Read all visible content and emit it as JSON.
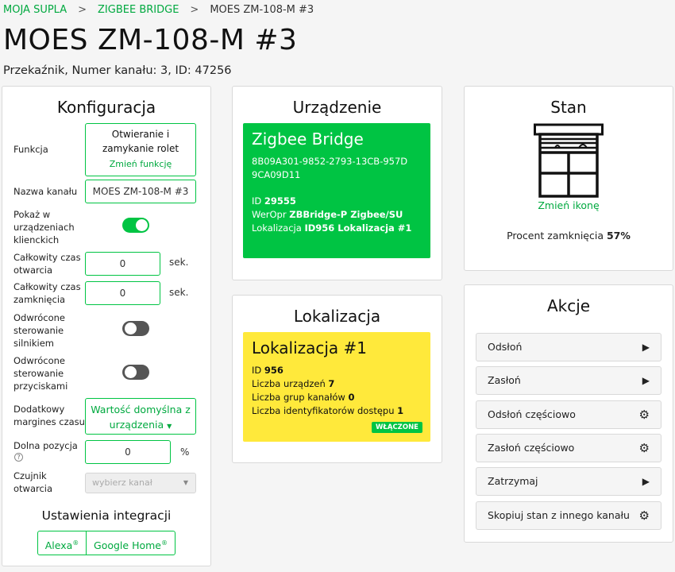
{
  "breadcrumb": {
    "item1": "MOJA SUPLA",
    "sep1": ">",
    "item2": "ZIGBEE BRIDGE",
    "sep2": ">",
    "item3": "MOES ZM-108-M #3"
  },
  "page": {
    "title": "MOES ZM-108-M #3",
    "subtitle": "Przekaźnik, Numer kanału: 3, ID: 47256"
  },
  "config": {
    "title": "Konfiguracja",
    "function_label": "Funkcja",
    "function_value": "Otwieranie i zamykanie rolet",
    "function_change": "Zmień funkcję",
    "channel_name_label": "Nazwa kanału",
    "channel_name_value": "MOES ZM-108-M #3",
    "show_in_clients_label": "Pokaż w urządzeniach klienckich",
    "show_in_clients": true,
    "open_time_label": "Całkowity czas otwarcia",
    "open_time_value": "0",
    "close_time_label": "Całkowity czas zamknięcia",
    "close_time_value": "0",
    "time_unit": "sek.",
    "reversed_motor_label": "Odwrócone sterowanie silnikiem",
    "reversed_motor": false,
    "reversed_buttons_label": "Odwrócone sterowanie przyciskami",
    "reversed_buttons": false,
    "margins_label": "Dodatkowy margines czasu",
    "margins_value": "Wartość domyślna z urządzenia",
    "bottom_pos_label": "Dolna pozycja",
    "bottom_pos_value": "0",
    "bottom_pos_unit": "%",
    "sensor_label": "Czujnik otwarcia",
    "sensor_placeholder": "wybierz kanał",
    "integrations_title": "Ustawienia integracji",
    "alexa": "Alexa",
    "google": "Google Home",
    "reg": "®"
  },
  "device": {
    "title": "Urządzenie",
    "name": "Zigbee Bridge",
    "guid": "8B09A301-9852-2793-13CB-957D9CA09D11",
    "id_label": "ID",
    "id_value": "29555",
    "weropr_label": "WerOpr",
    "weropr_value": "ZBBridge-P Zigbee/SU",
    "loc_label": "Lokalizacja",
    "loc_value": "ID956 Lokalizacja #1",
    "color": "#00c443"
  },
  "location": {
    "title": "Lokalizacja",
    "name": "Lokalizacja #1",
    "id_label": "ID",
    "id_value": "956",
    "devices_label": "Liczba urządzeń",
    "devices_value": "7",
    "groups_label": "Liczba grup kanałów",
    "groups_value": "0",
    "access_label": "Liczba identyfikatorów dostępu",
    "access_value": "1",
    "badge": "WŁĄCZONE",
    "color": "#ffe93b"
  },
  "state": {
    "title": "Stan",
    "icon": "roller-blind-window-icon",
    "change_icon": "Zmień ikonę",
    "percent_label": "Procent zamknięcia",
    "percent_value": "57%"
  },
  "actions": {
    "title": "Akcje",
    "items": [
      {
        "label": "Odsłoń",
        "icon": "play-icon"
      },
      {
        "label": "Zasłoń",
        "icon": "play-icon"
      },
      {
        "label": "Odsłoń częściowo",
        "icon": "gear-icon"
      },
      {
        "label": "Zasłoń częściowo",
        "icon": "gear-icon"
      },
      {
        "label": "Zatrzymaj",
        "icon": "play-icon"
      },
      {
        "label": "Skopiuj stan z innego kanału",
        "icon": "gear-icon"
      }
    ]
  },
  "accent": "#00a93f"
}
